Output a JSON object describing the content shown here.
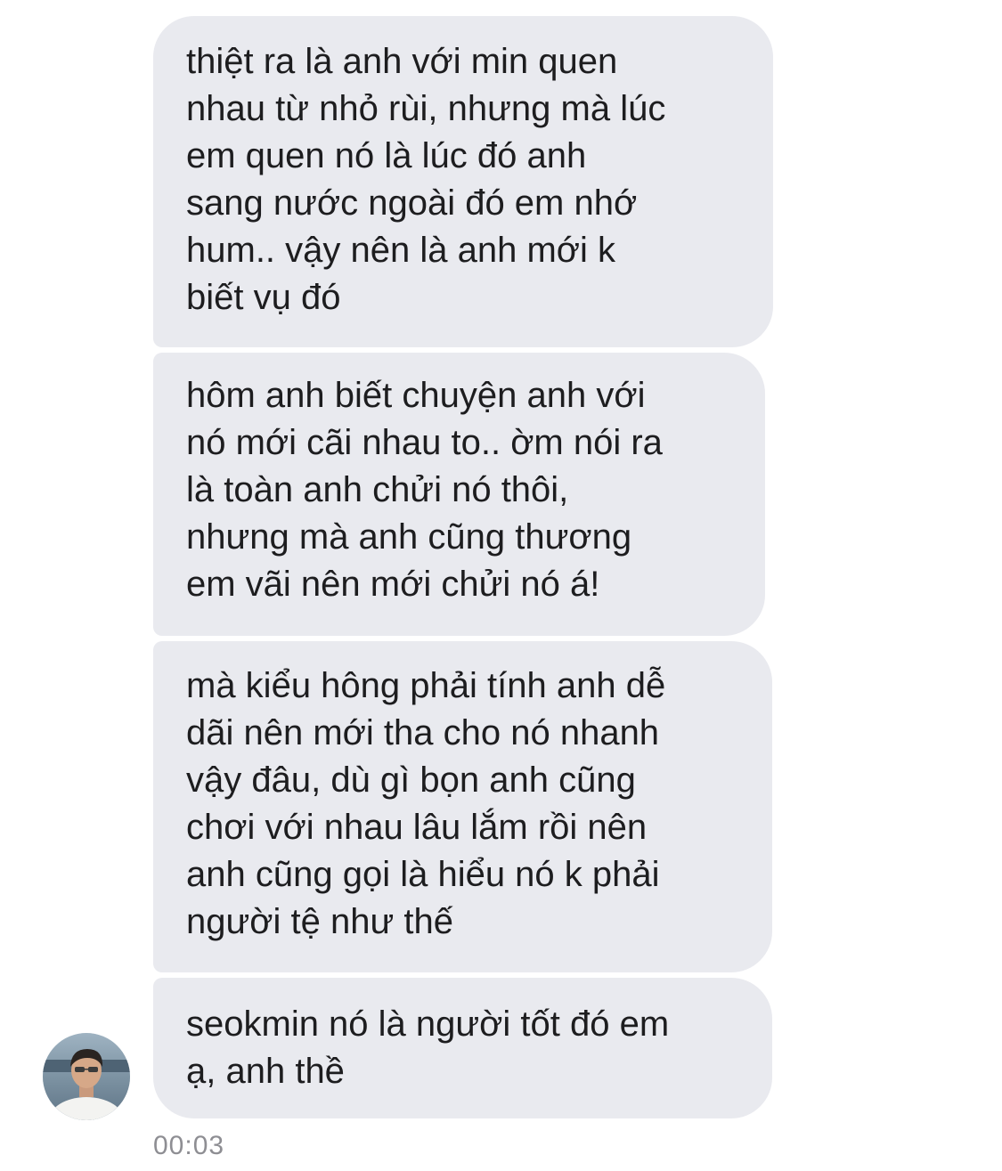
{
  "messages": [
    {
      "text": "thiệt ra là anh với min quen\nnhau từ nhỏ rùi, nhưng mà lúc\nem quen nó là lúc đó anh\nsang nước ngoài đó em nhớ\nhum.. vậy nên là anh mới k\nbiết vụ đó"
    },
    {
      "text": "hôm anh biết chuyện anh với\nnó mới cãi nhau to.. ờm nói ra\nlà toàn anh chửi nó thôi,\nnhưng mà anh cũng thương\nem vãi nên mới chửi nó á!"
    },
    {
      "text": "mà kiểu hông phải tính anh dễ\ndãi nên mới tha cho nó nhanh\nvậy đâu, dù gì bọn anh cũng\nchơi với nhau lâu lắm rồi nên\nanh cũng gọi là hiểu nó k phải\nngười tệ như thế"
    },
    {
      "text": "seokmin nó là người tốt đó em\nạ, anh thề"
    }
  ],
  "timestamp": "00:03",
  "colors": {
    "bubble_background": "#e9eaef",
    "message_text": "#1d1d1f",
    "timestamp_text": "#8e8e93"
  },
  "sender": {
    "avatar_icon": "person-avatar-photo"
  }
}
